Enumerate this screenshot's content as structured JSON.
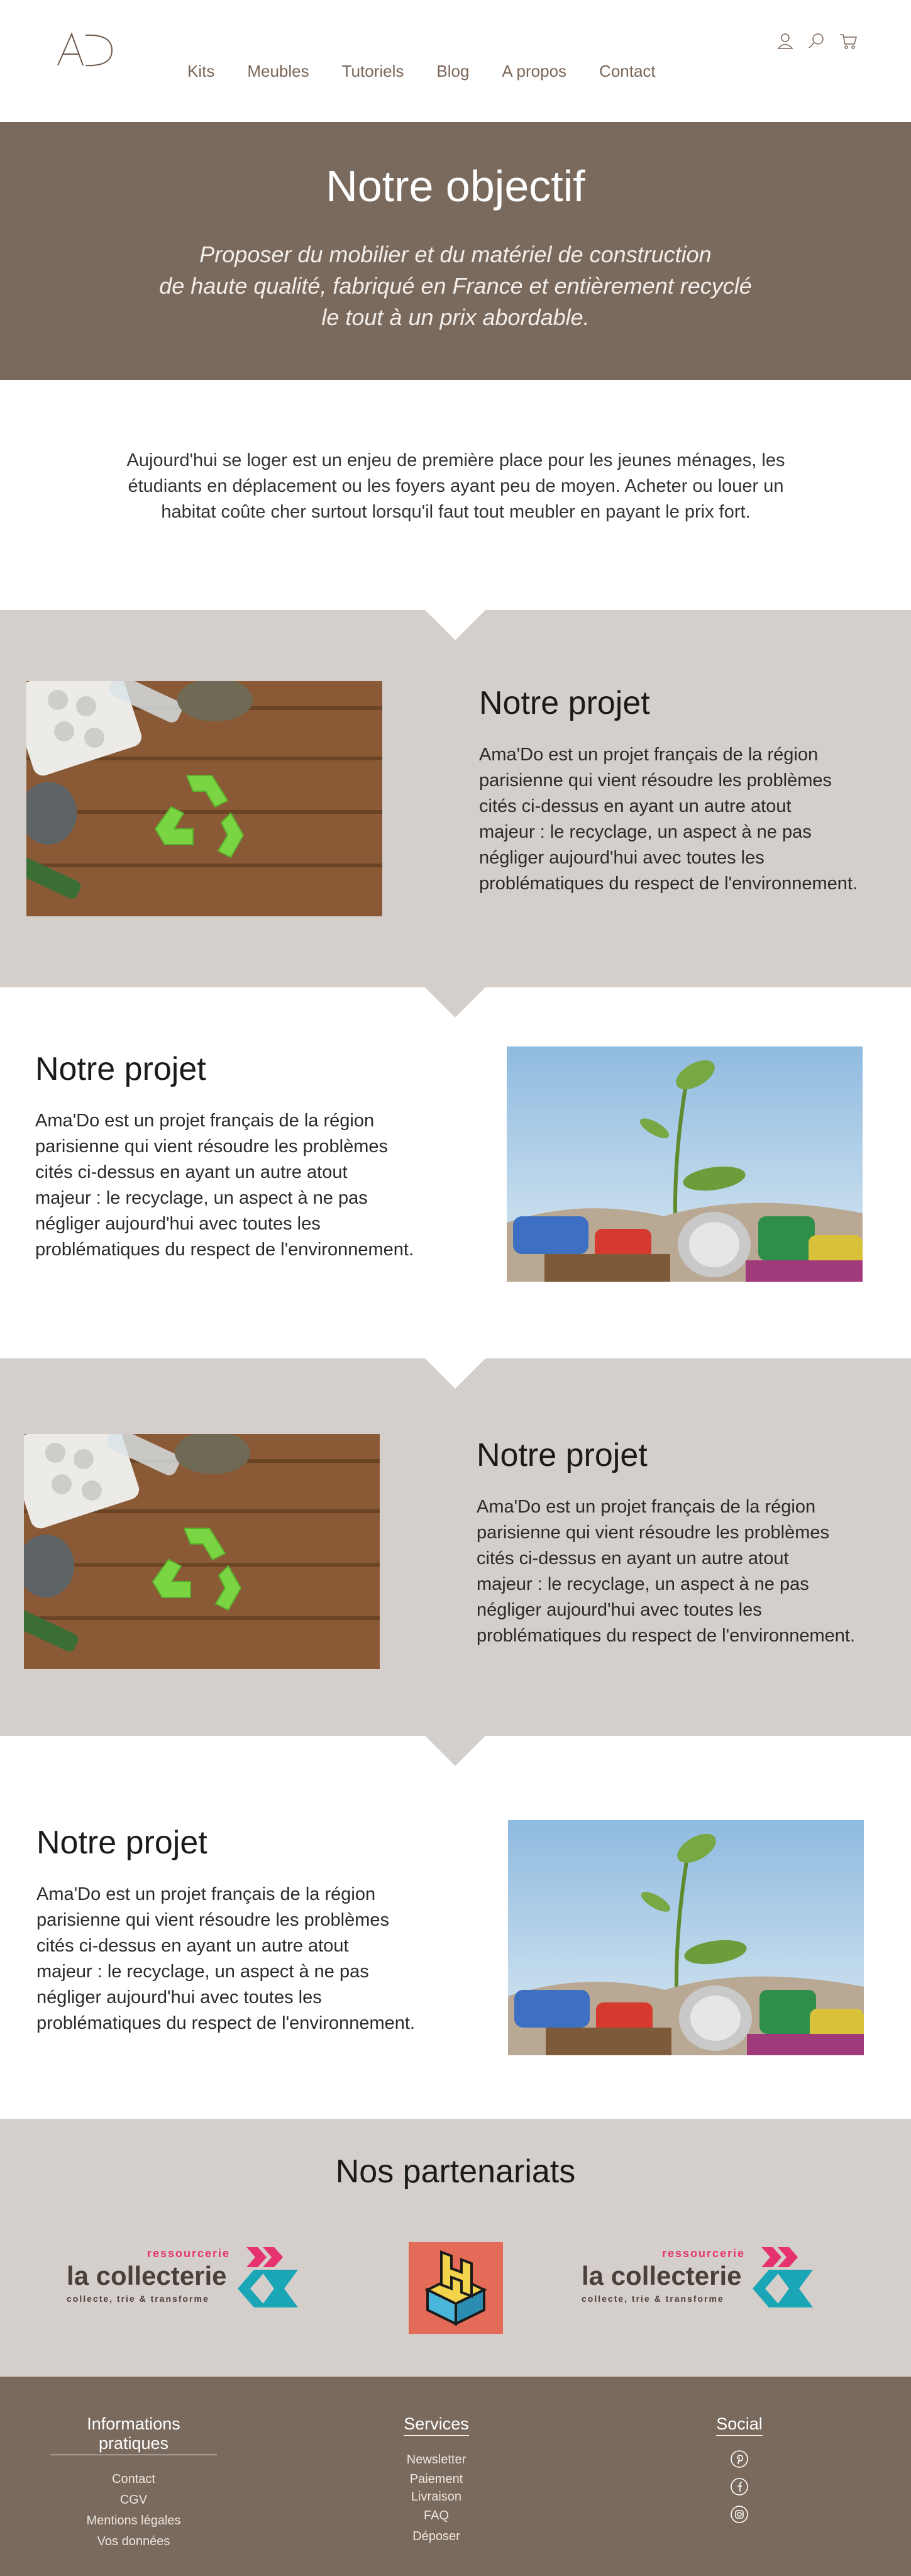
{
  "header": {
    "logo_text": "AD",
    "nav": [
      "Kits",
      "Meubles",
      "Tutoriels",
      "Blog",
      "A propos",
      "Contact"
    ],
    "icons": [
      "user-icon",
      "search-icon",
      "cart-icon"
    ]
  },
  "hero": {
    "title": "Notre objectif",
    "subtitle_lines": [
      "Proposer du mobilier et du matériel de construction",
      "de haute qualité, fabriqué en France et entièrement recyclé",
      "le tout à un prix abordable."
    ]
  },
  "intro": {
    "lines": [
      "Aujourd'hui se loger est un enjeu de première place pour les jeunes ménages, les",
      "étudiants en déplacement ou les foyers ayant peu de moyen. Acheter ou louer un",
      "habitat coûte cher surtout lorsqu'il faut tout meubler en payant le prix fort."
    ]
  },
  "sections": [
    {
      "title": "Notre projet",
      "lines": [
        "Ama'Do est un projet français de la région",
        "parisienne qui vient résoudre les problèmes",
        "cités ci-dessus en ayant un autre atout",
        "majeur : le recyclage, un aspect à ne pas",
        "négliger aujourd'hui avec toutes les",
        "problématiques du respect de l'environnement."
      ],
      "image": "recycling-symbol-on-wood"
    },
    {
      "title": "Notre projet",
      "lines": [
        "Ama'Do est un projet français de la région",
        "parisienne qui vient résoudre les problèmes",
        "cités ci-dessus en ayant un autre atout",
        "majeur : le recyclage, un aspect à ne pas",
        "négliger aujourd'hui avec toutes les",
        "problématiques du respect de l'environnement."
      ],
      "image": "plant-growing-from-cans"
    },
    {
      "title": "Notre projet",
      "lines": [
        "Ama'Do est un projet français de la région",
        "parisienne qui vient résoudre les problèmes",
        "cités ci-dessus en ayant un autre atout",
        "majeur : le recyclage, un aspect à ne pas",
        "négliger aujourd'hui avec toutes les",
        "problématiques du respect de l'environnement."
      ],
      "image": "recycling-symbol-on-wood"
    },
    {
      "title": "Notre projet",
      "lines": [
        "Ama'Do est un projet français de la région",
        "parisienne qui vient résoudre les problèmes",
        "cités ci-dessus en ayant un autre atout",
        "majeur : le recyclage, un aspect à ne pas",
        "négliger aujourd'hui avec toutes les",
        "problématiques du respect de l'environnement."
      ],
      "image": "plant-growing-from-cans"
    }
  ],
  "partners": {
    "title": "Nos partenariats",
    "logos": [
      {
        "name": "la collecterie",
        "top": "ressourcerie",
        "tagline": "collecte, trie & transforme"
      },
      {
        "name": "hack-logo",
        "letter": "H"
      },
      {
        "name": "la collecterie",
        "top": "ressourcerie",
        "tagline": "collecte, trie & transforme"
      }
    ]
  },
  "footer": {
    "info": {
      "title": "Informations pratiques",
      "links": [
        "Contact",
        "CGV",
        "Mentions légales",
        "Vos données"
      ]
    },
    "services": {
      "title": "Services",
      "links": [
        "Newsletter",
        "Paiement",
        "Livraison",
        "FAQ",
        "Déposer"
      ]
    },
    "social": {
      "title": "Social",
      "icons": [
        "pinterest-icon",
        "facebook-icon",
        "instagram-icon"
      ]
    }
  },
  "colors": {
    "brown": "#7a6a5d",
    "beige": "#d5cfcb",
    "nav_text": "#7a6556",
    "collecterie_pink": "#e6336f",
    "collecterie_teal": "#1aa6b7"
  }
}
